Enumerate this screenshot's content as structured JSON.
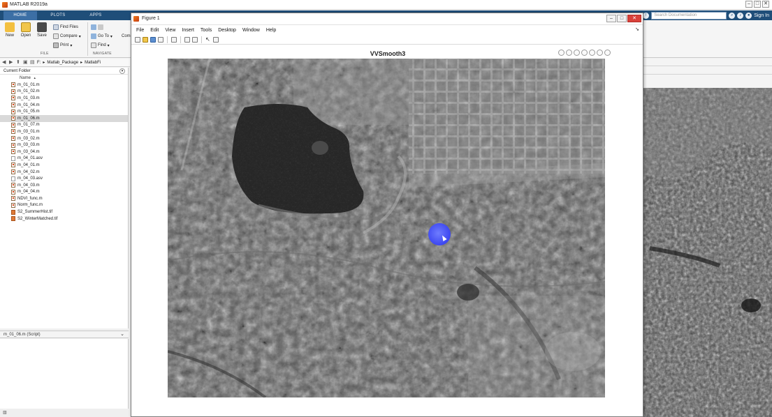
{
  "app": {
    "title": "MATLAB R2019a",
    "tabs": [
      {
        "label": "HOME"
      },
      {
        "label": "PLOTS"
      },
      {
        "label": "APPS"
      }
    ],
    "search_placeholder": "Search Documentation",
    "signin_label": "Sign In"
  },
  "ribbon": {
    "new_label": "New",
    "open_label": "Open",
    "save_label": "Save",
    "find_files_label": "Find Files",
    "compare_label": "Compare",
    "print_label": "Print",
    "goto_label": "Go To",
    "find_label": "Find",
    "com_label": "Com",
    "file_group": "FILE",
    "navigate_group": "NAVIGATE"
  },
  "address": {
    "crumb1": "F:",
    "crumb2": "Matlab_Package",
    "crumb3": "MatlabFi"
  },
  "folder": {
    "title": "Current Folder",
    "column_name": "Name",
    "sort_indicator": "▲",
    "files": [
      {
        "name": "m_01_01.m",
        "type": "m"
      },
      {
        "name": "m_01_02.m",
        "type": "m"
      },
      {
        "name": "m_01_03.m",
        "type": "m"
      },
      {
        "name": "m_01_04.m",
        "type": "m"
      },
      {
        "name": "m_01_05.m",
        "type": "m"
      },
      {
        "name": "m_01_06.m",
        "type": "m",
        "selected": true
      },
      {
        "name": "m_01_07.m",
        "type": "m"
      },
      {
        "name": "m_03_01.m",
        "type": "m"
      },
      {
        "name": "m_03_02.m",
        "type": "m"
      },
      {
        "name": "m_03_03.m",
        "type": "m"
      },
      {
        "name": "m_03_04.m",
        "type": "m"
      },
      {
        "name": "m_04_01.asv",
        "type": "asv"
      },
      {
        "name": "m_04_01.m",
        "type": "m"
      },
      {
        "name": "m_04_02.m",
        "type": "m"
      },
      {
        "name": "m_04_03.asv",
        "type": "asv"
      },
      {
        "name": "m_04_03.m",
        "type": "m"
      },
      {
        "name": "m_04_04.m",
        "type": "m"
      },
      {
        "name": "NDVI_func.m",
        "type": "m"
      },
      {
        "name": "Norm_func.m",
        "type": "m"
      },
      {
        "name": "S2_SummerHist.tif",
        "type": "tif"
      },
      {
        "name": "S2_WinterMatched.tif",
        "type": "tif"
      }
    ],
    "details_label": "m_01_06.m  (Script)"
  },
  "figure": {
    "title": "Figure 1",
    "menu": [
      "File",
      "Edit",
      "View",
      "Insert",
      "Tools",
      "Desktop",
      "Window",
      "Help"
    ],
    "axes_title": "VVSmooth3"
  },
  "colors": {
    "tab_strip": "#1f4e79",
    "cursor_highlight": "#4a55f2",
    "close_button": "#d9413a"
  }
}
